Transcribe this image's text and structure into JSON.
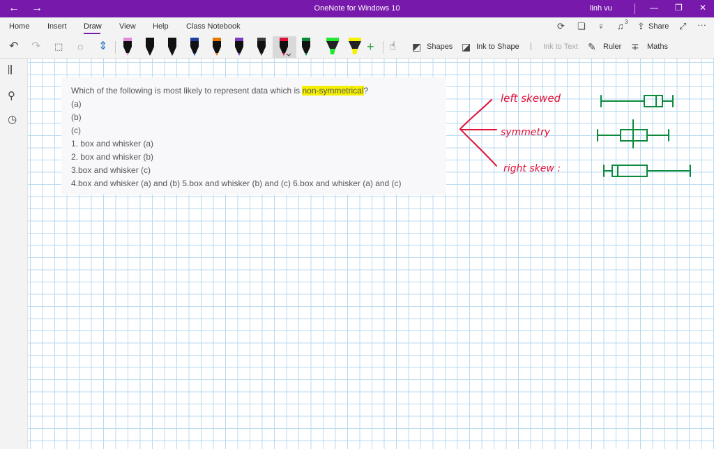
{
  "titlebar": {
    "title": "OneNote for Windows 10",
    "user": "linh vu",
    "back": "←",
    "forward": "→",
    "minimize": "—",
    "restore": "❐",
    "close": "✕"
  },
  "menu": {
    "home": "Home",
    "insert": "Insert",
    "draw": "Draw",
    "view": "View",
    "help": "Help",
    "class_notebook": "Class Notebook",
    "share": "Share",
    "more": "···"
  },
  "toolbar": {
    "shapes": "Shapes",
    "ink_to_shape": "Ink to Shape",
    "ink_to_text": "Ink to Text",
    "ruler": "Ruler",
    "maths": "Maths",
    "add_pen": "+",
    "pens": [
      {
        "name": "pen-pink",
        "color": "#e38ad9",
        "type": "pen"
      },
      {
        "name": "pen-black-1",
        "color": "#111111",
        "type": "pen"
      },
      {
        "name": "pen-black-2",
        "color": "#111111",
        "type": "pen"
      },
      {
        "name": "pen-blue",
        "color": "#1f3f9f",
        "type": "pen"
      },
      {
        "name": "pen-orange",
        "color": "#e67a00",
        "type": "pen"
      },
      {
        "name": "pen-purple",
        "color": "#7a3fbf",
        "type": "pen"
      },
      {
        "name": "pen-dark",
        "color": "#3a3a3a",
        "type": "pen"
      },
      {
        "name": "pen-red",
        "color": "#e0103a",
        "type": "pen"
      },
      {
        "name": "pen-green",
        "color": "#0c8a3c",
        "type": "pen"
      },
      {
        "name": "highlighter-green",
        "color": "#23e82f",
        "type": "highlighter"
      },
      {
        "name": "highlighter-yellow",
        "color": "#f5f000",
        "type": "highlighter"
      },
      {
        "name": "highlighter-pink",
        "color": "#ea3fd8",
        "type": "highlighter"
      }
    ]
  },
  "question": {
    "prefix": "Which of the following is most likely to represent data which is ",
    "highlighted": "non-symmetrical",
    "suffix": "?",
    "lines": [
      "(a)",
      "(b)",
      "(c)",
      "1. box and whisker (a)",
      "2. box and whisker (b)",
      "3.box and whisker (c)",
      "4.box and whisker (a) and (b) 5.box and whisker (b) and (c) 6.box and whisker (a) and (c)"
    ]
  },
  "ink": {
    "label_left": "left skewed",
    "label_sym": "symmetry",
    "label_right": "right skew :",
    "red_color": "#e0103a",
    "green_color": "#0c8a3c"
  },
  "notification_count": "3"
}
